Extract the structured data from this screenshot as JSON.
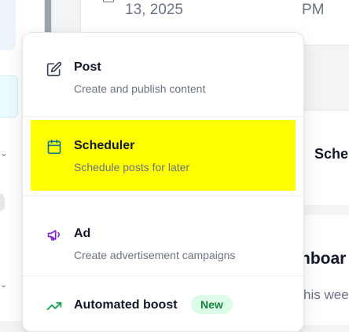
{
  "background": {
    "date_text": "13, 2025",
    "time_text": "PM",
    "section_title_partial": "Sche",
    "dashboard_partial": "nboar",
    "week_partial": "his wee"
  },
  "menu": {
    "items": [
      {
        "icon": "edit-icon",
        "title": "Post",
        "description": "Create and publish content",
        "highlighted": false
      },
      {
        "icon": "calendar-icon",
        "title": "Scheduler",
        "description": "Schedule posts for later",
        "highlighted": true
      },
      {
        "icon": "megaphone-icon",
        "title": "Ad",
        "description": "Create advertisement campaigns",
        "highlighted": false
      },
      {
        "icon": "trending-up-icon",
        "title": "Automated boost",
        "badge": "New",
        "highlighted": false
      }
    ]
  },
  "colors": {
    "highlight": "#ffff00",
    "post_icon": "#374151",
    "scheduler_icon": "#0e7490",
    "ad_icon": "#7e22ce",
    "boost_icon": "#16a34a",
    "badge_bg": "#dcfce7",
    "badge_text": "#15803d"
  }
}
